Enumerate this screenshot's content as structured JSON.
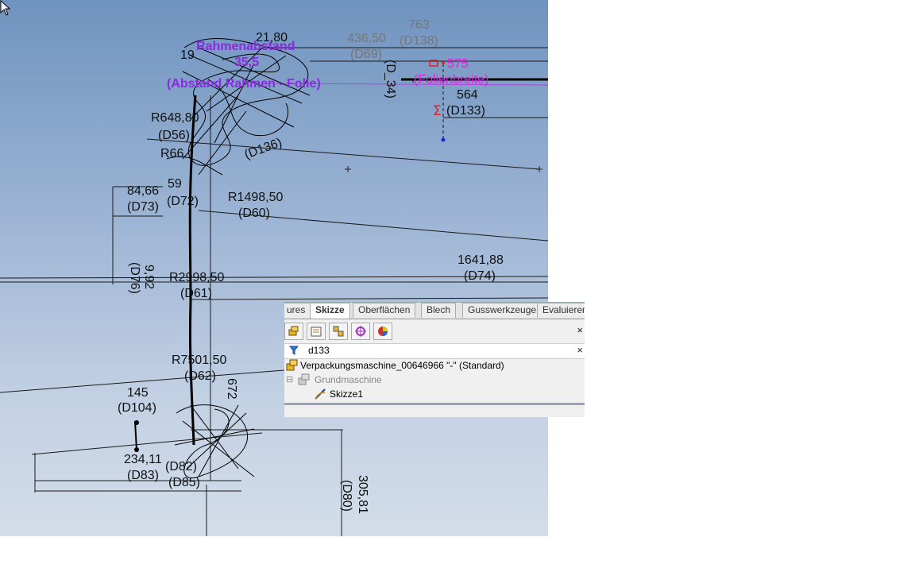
{
  "sketch": {
    "dims_black": [
      "21,80",
      "19",
      "R648,80",
      "(D56)",
      "R66",
      "59",
      "84,66",
      "(D73)",
      "(D72)",
      "R1498,50",
      "(D60)",
      "9,92",
      "(D76)",
      "R2998,50",
      "(D61)",
      "1641,88",
      "(D74)",
      "R7501,50",
      "(D62)",
      "672",
      "145",
      "(D104)",
      "234,11",
      "(D83)",
      "(D82)",
      "(D85)",
      "305,81",
      "(D80)",
      "564",
      "(D133)",
      "(D_34)",
      "(D136)"
    ],
    "dims_gray": [
      "436,50",
      "(D69)",
      "763",
      "(D138)"
    ],
    "dims_purple": [
      "Rahmenabstand",
      "35,5",
      "(Abstand Rahmen - Folie)"
    ],
    "dims_magenta": [
      "575",
      "(Folienbreite)"
    ],
    "sigma_symbol": "Σ"
  },
  "panel": {
    "tabs": [
      {
        "label": "ures",
        "active": false
      },
      {
        "label": "Skizze",
        "active": true
      },
      {
        "label": "Oberflächen",
        "active": false
      },
      {
        "label": "Blech",
        "active": false
      },
      {
        "label": "Gusswerkzeuge",
        "active": false
      },
      {
        "label": "Evaluieren",
        "active": false
      }
    ],
    "toolbar_icons": [
      "feature-manager-icon",
      "property-manager-icon",
      "configuration-manager-icon",
      "dimxpert-icon",
      "appearance-icon"
    ],
    "close_symbol": "×",
    "filter": {
      "value": "d133",
      "icon": "filter-icon"
    },
    "tree": {
      "root": "Verpackungsmaschine_00646966 \"-\"  (Standard)",
      "child": "Grundmaschine",
      "leaf": "Skizze1",
      "expander": "⊟"
    }
  },
  "colors": {
    "viewport_top": "#6f93bf",
    "viewport_bottom": "#d3dde9",
    "dimension_text": "#111111",
    "gray_text": "#777777",
    "purple": "#8a2be2",
    "magenta": "#e020e0",
    "relation_red": "#e02020",
    "point_blue": "#1a2cd8"
  }
}
